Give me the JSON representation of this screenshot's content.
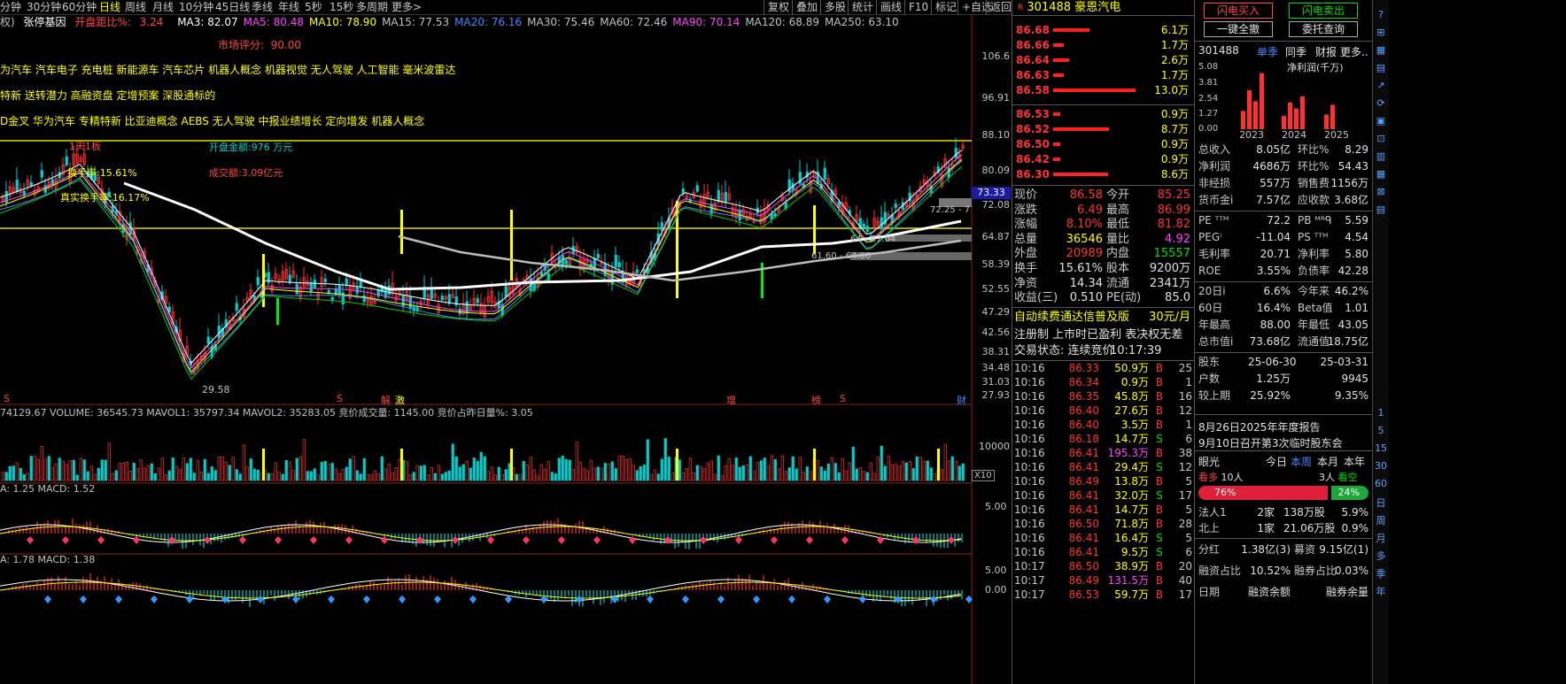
{
  "topbar": {
    "periods": [
      "分钟",
      "30分钟",
      "60分钟",
      "日线",
      "周线",
      "月线",
      "10分钟",
      "45日线",
      "季线",
      "年线",
      "5秒",
      "15秒",
      "多周期",
      "更多>"
    ],
    "active_period": "日线",
    "buttons": [
      "复权",
      "叠加",
      "多股",
      "统计",
      "画线",
      "F10",
      "标记",
      "+自选",
      "返回"
    ]
  },
  "mainchart": {
    "prefix": "权)",
    "indicator_name": "张停基因",
    "open_change_label": "开盘距比%:",
    "open_change_value": "3.24",
    "ma": [
      {
        "label": "MA3: 82.07",
        "color": "#ffffff"
      },
      {
        "label": "MA5: 80.48",
        "color": "#ff44ff"
      },
      {
        "label": "MA10: 78.90",
        "color": "#ffff00"
      },
      {
        "label": "MA15: 77.53",
        "color": "#c0c0c0"
      },
      {
        "label": "MA20: 76.16",
        "color": "#4488ff"
      },
      {
        "label": "MA30: 75.46",
        "color": "#c0c0c0"
      },
      {
        "label": "MA60: 72.46",
        "color": "#c0c0c0"
      },
      {
        "label": "MA90: 70.14",
        "color": "#ff44ff"
      },
      {
        "label": "MA120: 68.89",
        "color": "#c0c0c0"
      },
      {
        "label": "MA250: 63.10",
        "color": "#c0c0c0"
      }
    ],
    "market_score_label": "市场评分:",
    "market_score_value": "90.00",
    "concepts_1": "为汽车 汽车电子 充电桩 新能源车 汽车芯片 机器人概念 机器视觉 无人驾驶 人工智能 毫米波雷达",
    "concepts_2": "特新 送转潜力 高融资盘 定增预案 深股通标的",
    "concepts_3": "D金叉 华为汽车 专精特新 比亚迪概念 AEBS 无人驾驶 中报业绩增长 定向增发 机器人概念",
    "limit_label": "1天1板",
    "turnover_label": "换手率:15.61%",
    "real_turnover_label": "真实换手率:16.17%",
    "open_amount_label": "开盘金额:976 万元",
    "trade_amount_label": "成交额:3.09亿元",
    "low_label": "29.58",
    "band1_label": "72.25 - 7",
    "band2_label": "64 - 67.04",
    "band3_label": "61.60 - 64.00",
    "y_labels": [
      "106.6",
      "96.91",
      "88.10",
      "80.09",
      "72.08",
      "64.87",
      "58.39",
      "52.55",
      "47.29",
      "42.56",
      "38.31",
      "34.48",
      "31.03",
      "27.93"
    ],
    "current_price": "73.33",
    "markers": [
      "S",
      "S",
      "解",
      "激",
      "增",
      "榜",
      "S",
      "财"
    ]
  },
  "volume": {
    "label": "74129.67  VOLUME: 36545.73  MAVOL1: 35797.34  MAVOL2: 35283.05  竞价成交量: 1145.00  竞价占昨日量%: 3.05",
    "y_label": "10000",
    "unit": "X10"
  },
  "macd1": {
    "label": "A: 1.25  MACD: 1.52",
    "y_label": "5.00"
  },
  "macd2": {
    "label": "A: 1.78  MACD: 1.38",
    "y_labels": [
      "5.00",
      "0.00"
    ]
  },
  "quote": {
    "code": "301488",
    "name": "豪恩汽电",
    "sell": [
      {
        "p": "86.68",
        "v": "6.1万",
        "w": 0.27
      },
      {
        "p": "86.66",
        "v": "1.7万",
        "w": 0.08
      },
      {
        "p": "86.64",
        "v": "2.6万",
        "w": 0.12
      },
      {
        "p": "86.63",
        "v": "1.7万",
        "w": 0.08
      },
      {
        "p": "86.58",
        "v": "13.0万",
        "w": 0.62
      }
    ],
    "buy": [
      {
        "p": "86.53",
        "v": "0.9万",
        "w": 0.05
      },
      {
        "p": "86.52",
        "v": "8.7万",
        "w": 0.42
      },
      {
        "p": "86.50",
        "v": "0.9万",
        "w": 0.05
      },
      {
        "p": "86.42",
        "v": "0.9万",
        "w": 0.05
      },
      {
        "p": "86.30",
        "v": "8.6万",
        "w": 0.41
      }
    ],
    "stats": [
      {
        "l": "现价",
        "v": "86.58",
        "vc": "#ff3333",
        "l2": "今开",
        "v2": "85.25",
        "v2c": "#ff3333"
      },
      {
        "l": "涨跌",
        "v": "6.49",
        "vc": "#ff3333",
        "l2": "最高",
        "v2": "86.99",
        "v2c": "#ff3333"
      },
      {
        "l": "涨幅",
        "v": "8.10%",
        "vc": "#ff3333",
        "l2": "最低",
        "v2": "81.82",
        "v2c": "#ff3333"
      },
      {
        "l": "总量",
        "v": "36546",
        "vc": "#ffff00",
        "l2": "量比",
        "v2": "4.92",
        "v2c": "#ff44ff"
      },
      {
        "l": "外盘",
        "v": "20989",
        "vc": "#ff3333",
        "l2": "内盘",
        "v2": "15557",
        "v2c": "#00dd00"
      },
      {
        "l": "换手",
        "v": "15.61%",
        "vc": "#e0e0e0",
        "l2": "股本",
        "v2": "9200万",
        "v2c": "#e0e0e0"
      },
      {
        "l": "净资",
        "v": "14.34",
        "vc": "#e0e0e0",
        "l2": "流通",
        "v2": "2341万",
        "v2c": "#e0e0e0"
      },
      {
        "l": "收益(三)",
        "v": "0.510",
        "vc": "#e0e0e0",
        "l2": "PE(动)",
        "v2": "85.0",
        "v2c": "#e0e0e0"
      }
    ],
    "ad_text": "自动续费通达信普及版",
    "ad_price": "30元/月",
    "info_line": "注册制 上市时已盈利 表决权无差",
    "status_label": "交易状态:",
    "status_value": "连续竞价",
    "status_time": "10:17:39",
    "ticks": [
      {
        "t": "10:16",
        "p": "86.33",
        "v": "50.9万",
        "d": "B",
        "n": "25"
      },
      {
        "t": "10:16",
        "p": "86.34",
        "v": "0.9万",
        "d": "B",
        "n": "1"
      },
      {
        "t": "10:16",
        "p": "86.35",
        "v": "45.8万",
        "d": "B",
        "n": "16"
      },
      {
        "t": "10:16",
        "p": "86.40",
        "v": "27.6万",
        "d": "B",
        "n": "12"
      },
      {
        "t": "10:16",
        "p": "86.40",
        "v": "3.5万",
        "d": "B",
        "n": "1"
      },
      {
        "t": "10:16",
        "p": "86.18",
        "v": "14.7万",
        "d": "S",
        "n": "6"
      },
      {
        "t": "10:16",
        "p": "86.41",
        "v": "195.3万",
        "d": "B",
        "n": "38"
      },
      {
        "t": "10:16",
        "p": "86.41",
        "v": "29.4万",
        "d": "S",
        "n": "12"
      },
      {
        "t": "10:16",
        "p": "86.49",
        "v": "13.8万",
        "d": "B",
        "n": "5"
      },
      {
        "t": "10:16",
        "p": "86.41",
        "v": "32.0万",
        "d": "S",
        "n": "17"
      },
      {
        "t": "10:16",
        "p": "86.41",
        "v": "14.7万",
        "d": "B",
        "n": "5"
      },
      {
        "t": "10:16",
        "p": "86.50",
        "v": "71.8万",
        "d": "B",
        "n": "28"
      },
      {
        "t": "10:16",
        "p": "86.41",
        "v": "16.4万",
        "d": "S",
        "n": "5"
      },
      {
        "t": "10:16",
        "p": "86.41",
        "v": "9.5万",
        "d": "S",
        "n": "6"
      },
      {
        "t": "10:17",
        "p": "86.50",
        "v": "38.9万",
        "d": "B",
        "n": "20"
      },
      {
        "t": "10:17",
        "p": "86.49",
        "v": "131.5万",
        "d": "B",
        "n": "40"
      },
      {
        "t": "10:17",
        "p": "86.53",
        "v": "59.7万",
        "d": "B",
        "n": "17"
      }
    ]
  },
  "fin": {
    "flash_buy": "闪电买入",
    "flash_sell": "闪电卖出",
    "one_key_cancel": "一键全撤",
    "order_query": "委托查询",
    "code": "301488",
    "tabs": [
      "单季",
      "同季",
      "财报",
      "更多.."
    ],
    "chart_title": "净利润(千万)",
    "chart_y": [
      "5.08",
      "3.81",
      "2.54",
      "1.27",
      "0.00"
    ],
    "chart_x": [
      "2023",
      "2024",
      "2025"
    ],
    "chart_data": {
      "type": "bar",
      "title": "净利润(千万)",
      "categories": [
        "2023Q1",
        "2023Q2",
        "2023Q3",
        "2023Q4",
        "2024Q1",
        "2024Q2",
        "2024Q3",
        "2024Q4",
        "2025Q1",
        "2025Q2"
      ],
      "values": [
        1.5,
        3.2,
        2.3,
        4.6,
        1.1,
        2.2,
        1.7,
        2.7,
        1.2,
        2.0
      ],
      "ylim": [
        0,
        5.08
      ]
    },
    "rows": [
      {
        "a": "总收入",
        "b": "8.05亿",
        "c": "环比%",
        "d": "8.29"
      },
      {
        "a": "净利润",
        "b": "4686万",
        "c": "环比%",
        "d": "54.43"
      },
      {
        "a": "非经损",
        "b": "557万",
        "c": "销售费",
        "d": "1156万"
      },
      {
        "a": "货币金i",
        "b": "7.57亿",
        "c": "应收款",
        "d": "3.68亿"
      },
      {
        "a": "",
        "b": "",
        "c": "",
        "d": ""
      },
      {
        "a": "PE ᵀᵀᴹ",
        "b": "72.2",
        "c": "PB ᴹᴿᑫ",
        "d": "5.59"
      },
      {
        "a": "PEGⁱ",
        "b": "-11.04",
        "c": "PS ᵀᵀᴹ",
        "d": "4.54"
      },
      {
        "a": "毛利率",
        "b": "20.71",
        "c": "净利率",
        "d": "5.80"
      },
      {
        "a": "ROE",
        "b": "3.55%",
        "c": "负债率",
        "d": "42.28"
      },
      {
        "a": "",
        "b": "",
        "c": "",
        "d": ""
      },
      {
        "a": "20日i",
        "b": "6.6%",
        "c": "今年来",
        "d": "46.2%"
      },
      {
        "a": "60日",
        "b": "16.4%",
        "c": "Beta值",
        "d": "1.01"
      },
      {
        "a": "年最高",
        "b": "88.00",
        "c": "年最低",
        "d": "43.05"
      },
      {
        "a": "总市值i",
        "b": "73.68亿",
        "c": "流通值i",
        "d": "18.75亿"
      },
      {
        "a": "",
        "b": "",
        "c": "",
        "d": ""
      },
      {
        "a": "股东",
        "b": "25-06-30",
        "c": "",
        "d": "25-03-31"
      },
      {
        "a": "户数",
        "b": "1.25万",
        "c": "",
        "d": "9945"
      },
      {
        "a": "较上期",
        "b": "25.92%",
        "c": "",
        "d": "9.35%"
      }
    ],
    "notes": [
      "8月26日2025年年度报告",
      "9月10日召开第3次临时股东会"
    ],
    "eye_label": "眼光",
    "eye_tabs": [
      "今日",
      "本周",
      "本月",
      "本年"
    ],
    "bull_label": "看多",
    "bull_count": "10人",
    "bear_count": "3人",
    "bear_label": "看空",
    "bull_pct": "76%",
    "bear_pct": "24%",
    "bull_frac": 0.76,
    "hold_rows": [
      {
        "a": "法人1",
        "b": "2家",
        "c": "138万股",
        "d": "5.9%"
      },
      {
        "a": "北上",
        "b": "1家",
        "c": "21.06万股",
        "d": "0.9%"
      }
    ],
    "div_rows": [
      {
        "a": "分红",
        "b": "1.38亿(3)",
        "c": "募资",
        "d": "9.15亿(1)"
      },
      {
        "a": "融资占比",
        "b": "10.52%",
        "c": "融券占比",
        "d": "0.03%"
      },
      {
        "a": "日期",
        "b": "融资余额",
        "c": "",
        "d": "融券余量"
      }
    ]
  },
  "toolbar": {
    "side_periods": [
      "1",
      "5",
      "15",
      "30",
      "60",
      "日",
      "周",
      "月",
      "多",
      "季",
      "年"
    ]
  }
}
